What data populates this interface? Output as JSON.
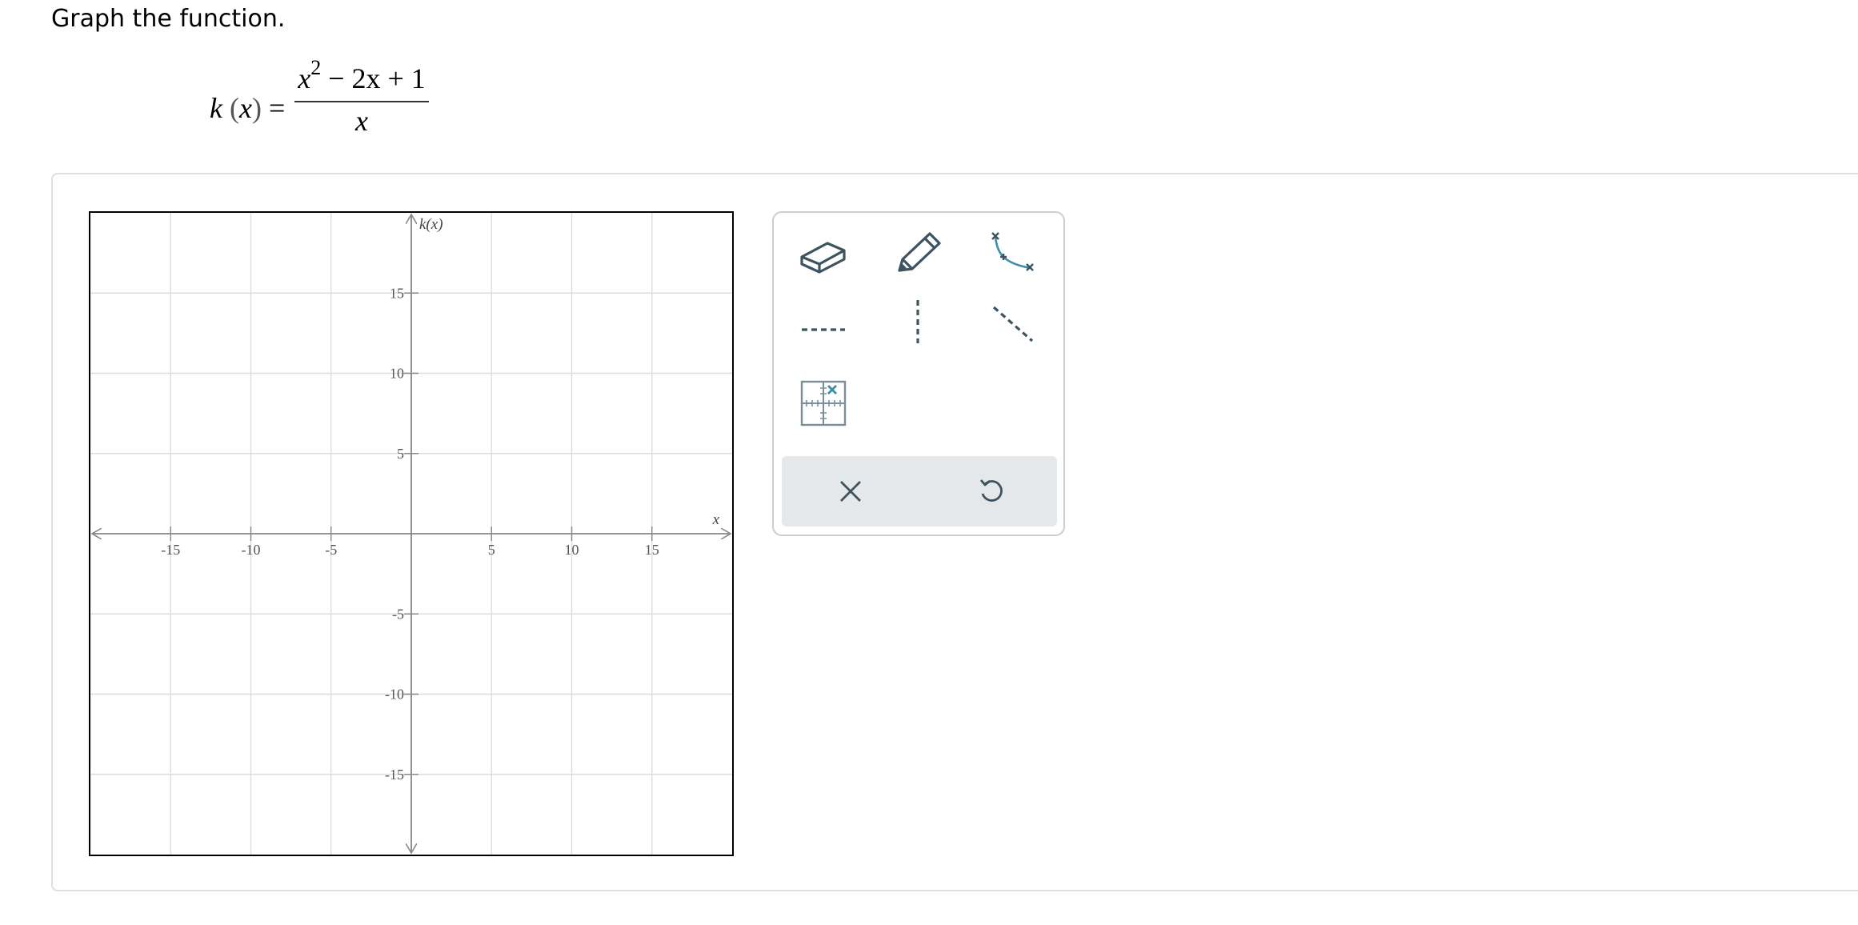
{
  "prompt": "Graph the function.",
  "formula": {
    "lhs_name": "k",
    "lhs_var": "x",
    "num_base": "x",
    "num_exp": "2",
    "num_rest": " − 2x + 1",
    "denominator": "x"
  },
  "graph": {
    "x_axis_label": "x",
    "y_axis_label": "k(x)",
    "xlim": [
      -20,
      20
    ],
    "ylim": [
      -20,
      20
    ],
    "grid_step": 5,
    "x_tick_labels": [
      "-15",
      "-10",
      "-5",
      "5",
      "10",
      "15"
    ],
    "y_tick_labels": [
      "15",
      "10",
      "5",
      "-5",
      "-10",
      "-15"
    ],
    "x_ticks": [
      -15,
      -10,
      -5,
      5,
      10,
      15
    ],
    "y_ticks": [
      15,
      10,
      5,
      -5,
      -10,
      -15
    ]
  },
  "toolbox": {
    "tools": [
      "eraser-icon",
      "pencil-icon",
      "curve-points-icon",
      "horizontal-asymptote-icon",
      "vertical-asymptote-icon",
      "slant-asymptote-icon",
      "zoom-grid-icon"
    ],
    "actions": [
      "close-icon",
      "undo-icon"
    ]
  },
  "colors": {
    "tool_dark": "#3d5460",
    "tool_accent": "#3e8ea6",
    "grid": "#dddddd",
    "axis": "#888888",
    "action_bar": "#e4e8eb"
  }
}
